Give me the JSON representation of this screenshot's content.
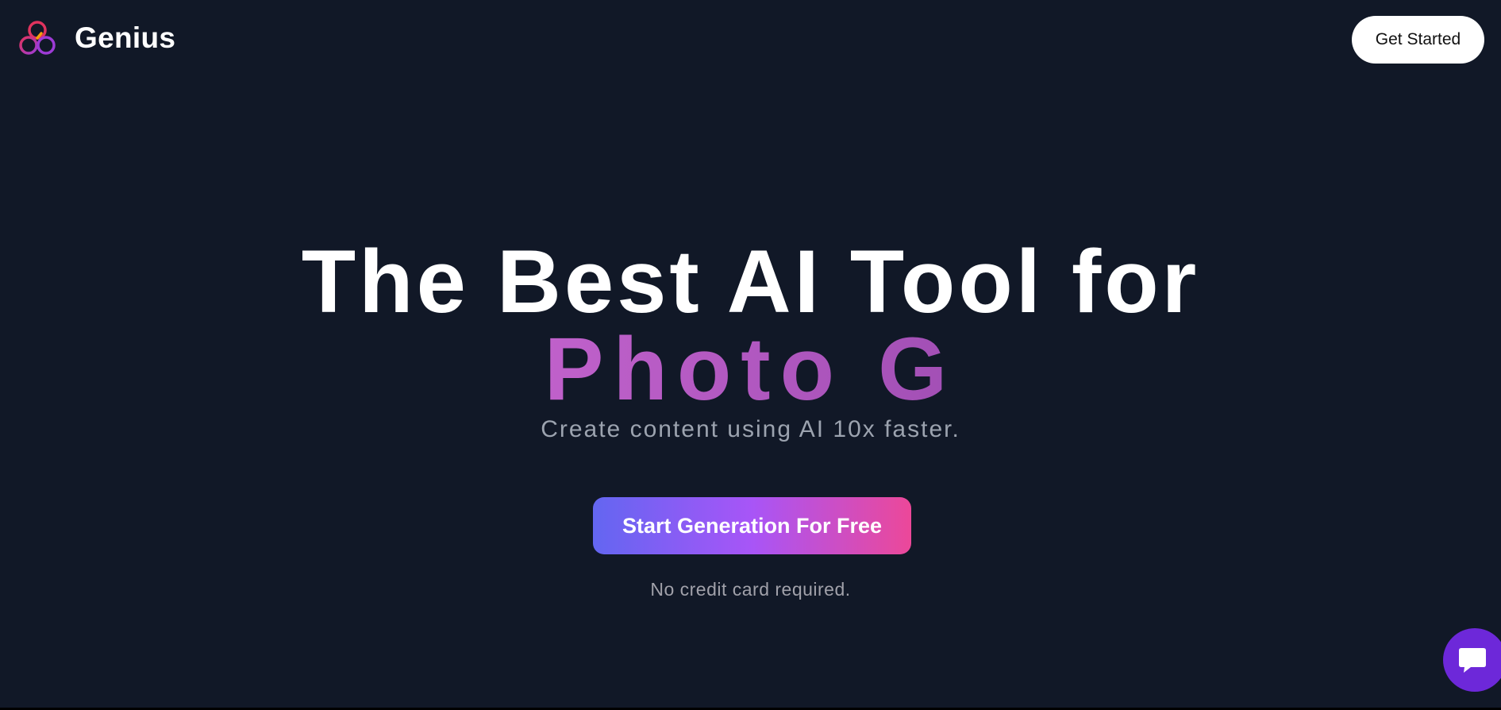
{
  "header": {
    "brand_name": "Genius",
    "logo_icon": "intertwined-rings-logo-icon",
    "get_started_label": "Get Started"
  },
  "hero": {
    "headline": "The Best AI Tool for",
    "typed_text": "Photo G",
    "subtitle": "Create content using AI 10x faster.",
    "cta_label": "Start Generation For Free",
    "note": "No credit card required."
  },
  "chat_widget": {
    "icon": "chat-icon"
  },
  "colors": {
    "background": "#111827",
    "typed_text": "#b25bc4",
    "cta_gradient_start": "#6366f1",
    "cta_gradient_mid": "#a855f7",
    "cta_gradient_end": "#ec4899",
    "chat_bubble": "#6d28d9",
    "get_started_bg": "#ffffff"
  }
}
